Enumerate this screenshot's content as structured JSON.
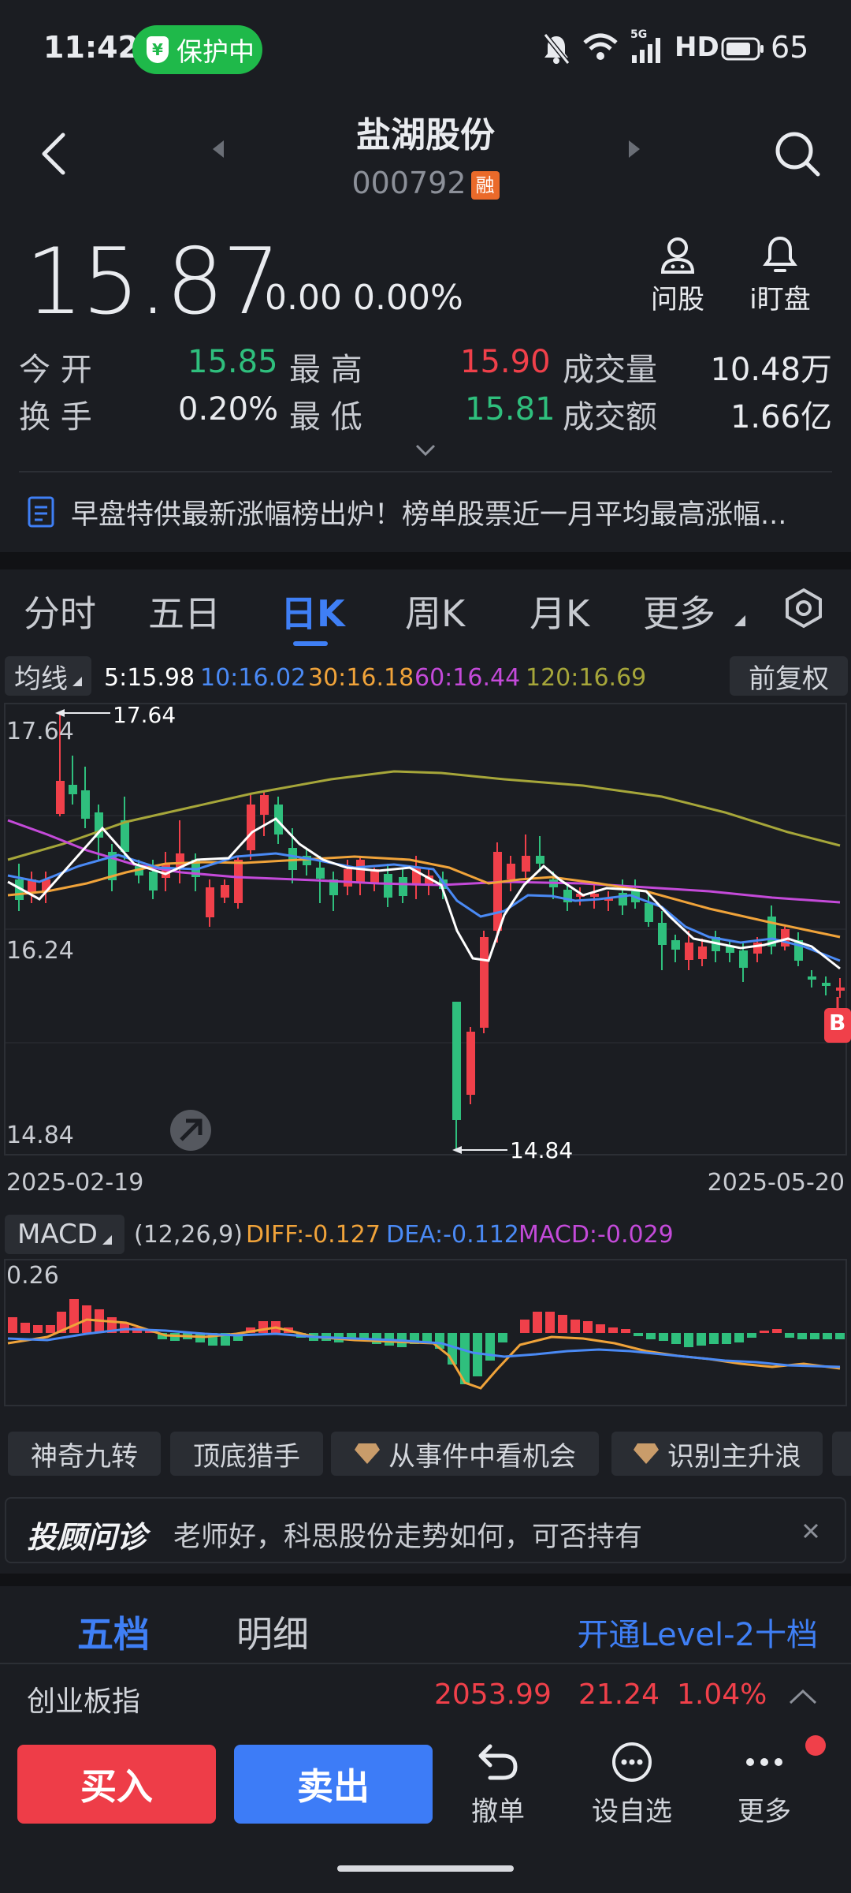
{
  "status": {
    "time": "11:42",
    "protect_label": "保护中",
    "network": "5G",
    "hd": "HD",
    "battery": "65"
  },
  "header": {
    "name": "盐湖股份",
    "code": "000792",
    "margin_badge": "融"
  },
  "quote": {
    "price": "15.87",
    "change": "0.00",
    "change_pct": "0.00%",
    "open_label": "今 开",
    "open": "15.85",
    "high_label": "最 高",
    "high": "15.90",
    "volume_label": "成交量",
    "volume": "10.48万",
    "turnover_label": "换 手",
    "turnover": "0.20%",
    "low_label": "最 低",
    "low": "15.81",
    "amount_label": "成交额",
    "amount": "1.66亿"
  },
  "actions": {
    "ask": "问股",
    "watch": "i盯盘"
  },
  "news": {
    "text": "早盘特供最新涨幅榜出炉！榜单股票近一月平均最高涨幅..."
  },
  "tabs": [
    "分时",
    "五日",
    "日K",
    "周K",
    "月K",
    "更多"
  ],
  "active_tab": "日K",
  "ma": {
    "label": "均线",
    "ma5": "5:15.98",
    "ma10": "10:16.02",
    "ma30": "30:16.18",
    "ma60": "60:16.44",
    "ma120": "120:16.69",
    "adjust": "前复权"
  },
  "kline": {
    "top_label": "17.64",
    "mid_label": "16.24",
    "bottom_label": "14.84",
    "high_marker": "17.64",
    "low_marker": "14.84",
    "start_date": "2025-02-19",
    "end_date": "2025-05-20",
    "buy_marker": "B"
  },
  "macd": {
    "label": "MACD",
    "params": "(12,26,9)",
    "diff": "DIFF:-0.127",
    "dea": "DEA:-0.112",
    "macd": "MACD:-0.029",
    "top_label": "0.26"
  },
  "tools": [
    "神奇九转",
    "顶底猎手",
    "从事件中看机会",
    "识别主升浪"
  ],
  "advisor": {
    "brand": "投顾问诊",
    "text": "老师好，科思股份走势如何，可否持有"
  },
  "order_tabs": {
    "five": "五档",
    "detail": "明细",
    "level2": "开通Level-2十档"
  },
  "index": {
    "name": "创业板指",
    "value": "2053.99",
    "change": "21.24",
    "pct": "1.04%"
  },
  "bottom": {
    "buy": "买入",
    "sell": "卖出",
    "cancel": "撤单",
    "watchlist": "设自选",
    "more": "更多"
  },
  "colors": {
    "up": "#f0404a",
    "down": "#2fbf7d",
    "accent": "#3f7ff5",
    "ma5": "#ffffff",
    "ma10": "#4a8af5",
    "ma30": "#f0a33a",
    "ma60": "#c44ad9",
    "ma120": "#a6a63a"
  }
}
